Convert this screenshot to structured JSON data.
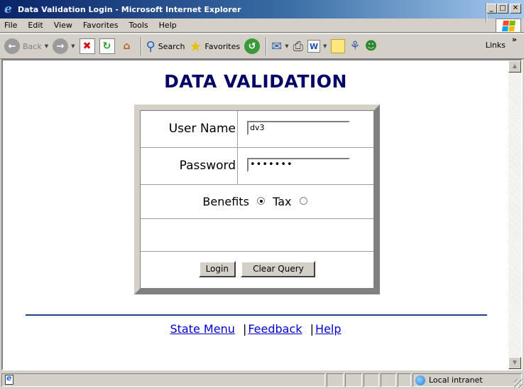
{
  "window": {
    "title": "Data Validation Login - Microsoft Internet Explorer",
    "minimize": "_",
    "maximize": "□",
    "close": "✕"
  },
  "menu": {
    "items": [
      "File",
      "Edit",
      "View",
      "Favorites",
      "Tools",
      "Help"
    ]
  },
  "toolbar": {
    "back_label": "Back",
    "search_label": "Search",
    "favorites_label": "Favorites",
    "links_label": "Links"
  },
  "page": {
    "title": "DATA VALIDATION",
    "username_label": "User Name",
    "username_value": "dv3",
    "password_label": "Password",
    "password_value": "•••••••",
    "radio_benefits": "Benefits",
    "radio_tax": "Tax",
    "selected_option": "Benefits",
    "login_button": "Login",
    "clear_button": "Clear Query",
    "links": {
      "state_menu": "State Menu",
      "feedback": "Feedback",
      "help": "Help",
      "separator": "|"
    }
  },
  "status": {
    "zone": "Local intranet"
  }
}
